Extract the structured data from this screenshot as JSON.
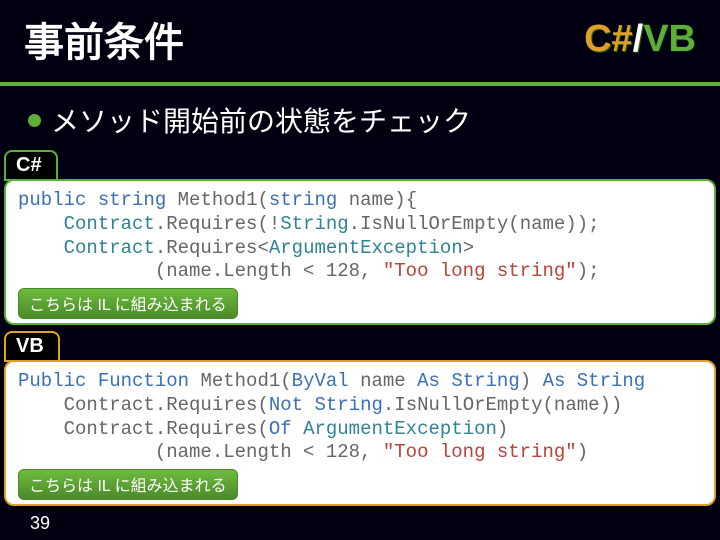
{
  "header": {
    "title": "事前条件",
    "cs": "C#",
    "slash": "/",
    "vb": "VB"
  },
  "subhead": "メソッド開始前の状態をチェック",
  "csharp": {
    "tag": "C#",
    "line1_a": "public",
    "line1_b": " ",
    "line1_c": "string",
    "line1_d": " Method1(",
    "line1_e": "string",
    "line1_f": " name){",
    "line2_a": "    ",
    "line2_b": "Contract",
    "line2_c": ".Requires(!",
    "line2_d": "String",
    "line2_e": ".IsNullOrEmpty(name));",
    "line3_a": "    ",
    "line3_b": "Contract",
    "line3_c": ".Requires<",
    "line3_d": "ArgumentException",
    "line3_e": ">",
    "line4_a": "            (name.Length < 128, ",
    "line4_b": "\"Too long string\"",
    "line4_c": ");",
    "note": "こちらは IL に組み込まれる"
  },
  "vbnet": {
    "tag": "VB",
    "line1_a": "Public",
    "line1_b": " ",
    "line1_c": "Function",
    "line1_d": " Method1(",
    "line1_e": "ByVal",
    "line1_f": " name ",
    "line1_g": "As",
    "line1_h": " ",
    "line1_i": "String",
    "line1_j": ") ",
    "line1_k": "As",
    "line1_l": " ",
    "line1_m": "String",
    "line2_a": "    Contract.Requires(",
    "line2_b": "Not",
    "line2_c": " ",
    "line2_d": "String",
    "line2_e": ".IsNullOrEmpty(name))",
    "line3_a": "    Contract.Requires(",
    "line3_b": "Of",
    "line3_c": " ",
    "line3_d": "ArgumentException",
    "line3_e": ")",
    "line4_a": "            (name.Length < 128, ",
    "line4_b": "\"Too long string\"",
    "line4_c": ")",
    "note": "こちらは IL に組み込まれる"
  },
  "pagenum": "39"
}
